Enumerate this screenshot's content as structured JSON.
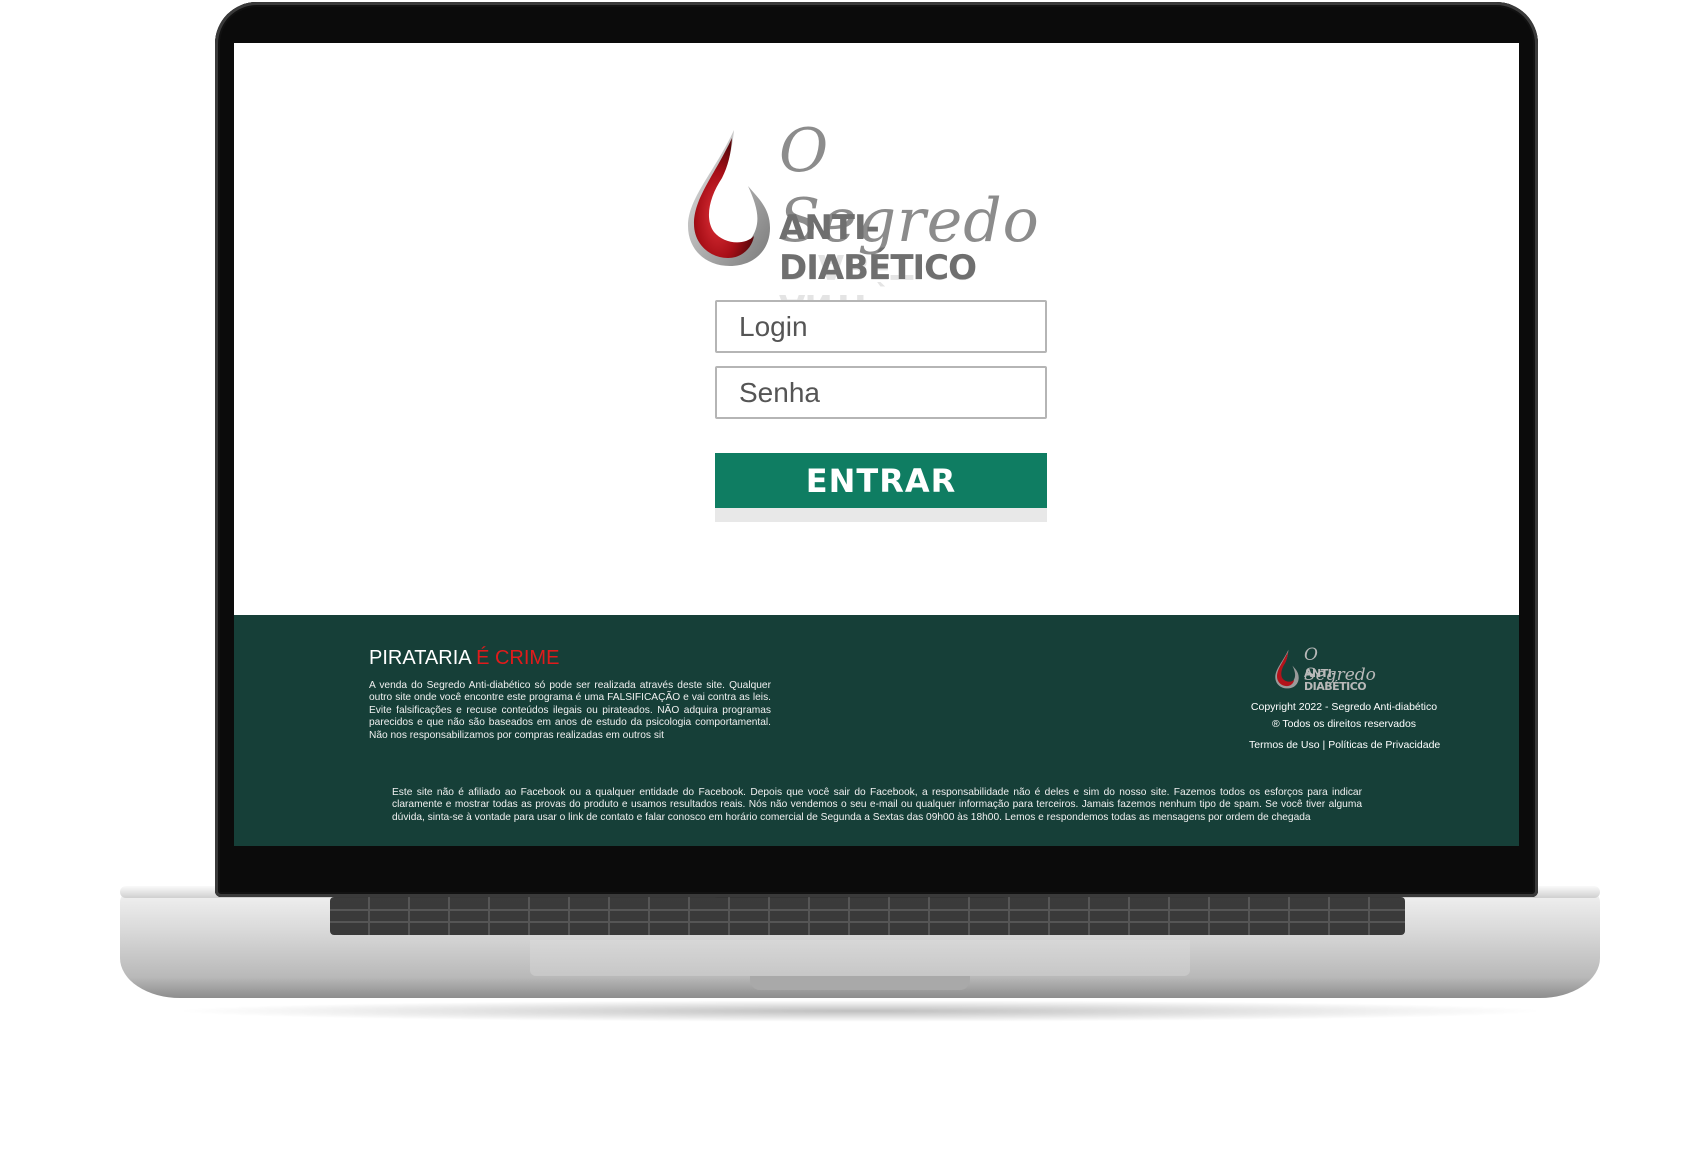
{
  "logo": {
    "title": "O Segredo",
    "subtitle": "ANTI-DIABÉTICO"
  },
  "form": {
    "login_placeholder": "Login",
    "password_placeholder": "Senha",
    "submit_label": "ENTRAR"
  },
  "footer": {
    "piracy_title": "PIRATARIA",
    "piracy_title_highlight": "É CRIME",
    "piracy_text": "A venda do Segredo Anti-diabético só pode ser realizada através deste site. Qualquer outro site onde você encontre este programa é uma FALSIFICAÇÃO e vai contra as leis. Evite falsificações e recuse conteúdos ilegais ou pirateados. NÃO adquira programas parecidos e que não são baseados em anos de estudo da psicologia comportamental. Não nos responsabilizamos por compras realizadas em outros sit",
    "mini_logo_title": "O Segredo",
    "mini_logo_subtitle": "ANTI-DIABÉTICO",
    "copyright": "Copyright 2022 - Segredo Anti-diabético",
    "rights": "® Todos os direitos reservados",
    "terms_link": "Termos de Uso",
    "separator": "|",
    "privacy_link": "Políticas de Privacidade",
    "disclaimer": "Este site não é afiliado ao Facebook ou a qualquer entidade do Facebook. Depois que você sair do Facebook, a responsabilidade não é deles e sim do nosso site. Fazemos todos os esforços para indicar claramente e mostrar todas as provas do produto e usamos resultados reais. Nós não vendemos o seu e-mail ou qualquer informação para terceiros. Jamais fazemos nenhum tipo de spam. Se você tiver alguma dúvida, sinta-se à vontade para usar o link de contato e falar conosco em horário comercial de Segunda a Sextas das 09h00 às 18h00. Lemos e respondemos todas as mensagens por ordem de chegada"
  },
  "colors": {
    "button": "#0f7d62",
    "footer_bg": "#163f38",
    "highlight_red": "#e01b1b",
    "drop_red": "#b3131b"
  },
  "icons": {
    "logo_drop": "blood-drop-icon"
  }
}
